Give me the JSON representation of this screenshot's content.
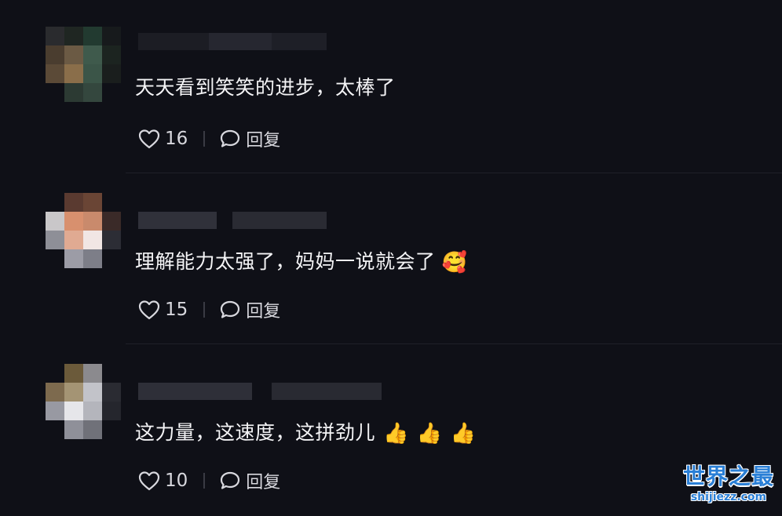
{
  "comments": [
    {
      "text": "天天看到笑笑的进步，太棒了",
      "likes": "16",
      "reply_label": "回复",
      "emojis": []
    },
    {
      "text": "理解能力太强了，妈妈一说就会了",
      "likes": "15",
      "reply_label": "回复",
      "emojis": [
        "🥰"
      ]
    },
    {
      "text": "这力量，这速度，这拼劲儿",
      "likes": "10",
      "reply_label": "回复",
      "emojis": [
        "👍",
        "👍",
        "👍"
      ]
    }
  ],
  "watermark": {
    "title": "世界之最",
    "url": "shijiezz.com"
  },
  "icons": {
    "like": "heart-outline-icon",
    "reply": "speech-bubble-icon"
  },
  "colors": {
    "background": "#0f1017",
    "text": "#f4f4f6",
    "secondary_text": "#d8d8de",
    "watermark": "#2a7fd6"
  }
}
